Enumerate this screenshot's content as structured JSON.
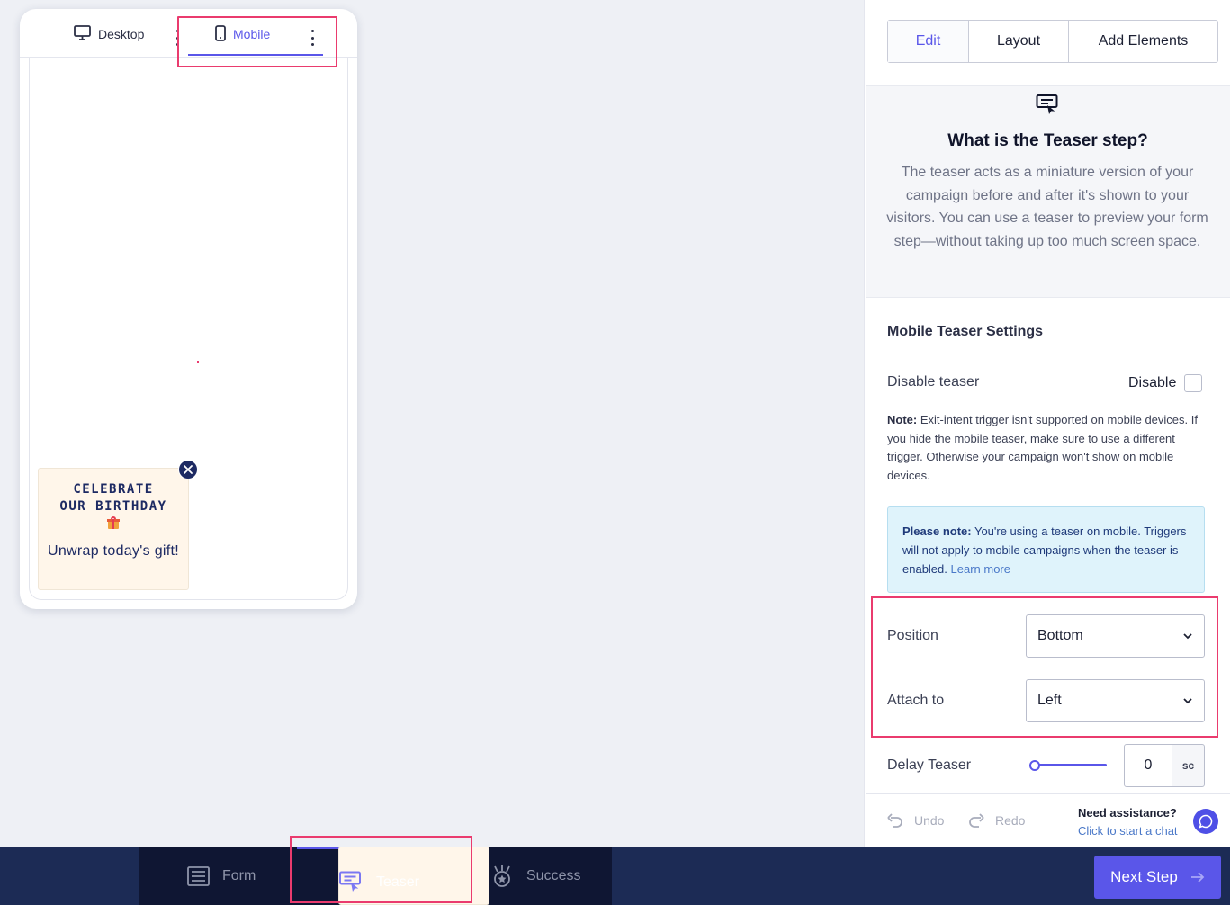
{
  "device_tabs": {
    "desktop": "Desktop",
    "mobile": "Mobile"
  },
  "teaser": {
    "title_line1": "CELEBRATE",
    "title_line2": "OUR BIRTHDAY",
    "subtitle": "Unwrap today's gift!"
  },
  "panel": {
    "tabs": {
      "edit": "Edit",
      "layout": "Layout",
      "add_elements": "Add Elements"
    },
    "info": {
      "title": "What is the Teaser step?",
      "body": "The teaser acts as a miniature version of your campaign before and after it's shown to your visitors. You can use a teaser to preview your form step—without taking up too much screen space."
    },
    "section_title": "Mobile Teaser Settings",
    "disable_teaser": {
      "label": "Disable teaser",
      "checkbox_label": "Disable",
      "checked": false
    },
    "note": {
      "prefix": "Note:",
      "text": " Exit-intent trigger isn't supported on mobile devices. If you hide the mobile teaser, make sure to use a different trigger. Otherwise your campaign won't show on mobile devices."
    },
    "alert": {
      "prefix": "Please note:",
      "text": " You're using a teaser on mobile. Triggers will not apply to mobile campaigns when the teaser is enabled. ",
      "link": "Learn more"
    },
    "position": {
      "label": "Position",
      "value": "Bottom"
    },
    "attach_to": {
      "label": "Attach to",
      "value": "Left"
    },
    "delay": {
      "label": "Delay Teaser",
      "value": "0",
      "unit": "sc"
    },
    "footer": {
      "undo": "Undo",
      "redo": "Redo",
      "assist_title": "Need assistance?",
      "assist_link": "Click to start a chat"
    }
  },
  "steps": {
    "form": "Form",
    "teaser": "Teaser",
    "success": "Success",
    "active": "teaser"
  },
  "next_button": "Next Step",
  "colors": {
    "accent": "#5a56e9",
    "highlight": "#ea3b6e",
    "navy": "#1c2b55",
    "teaser_text": "#1d2a63"
  }
}
